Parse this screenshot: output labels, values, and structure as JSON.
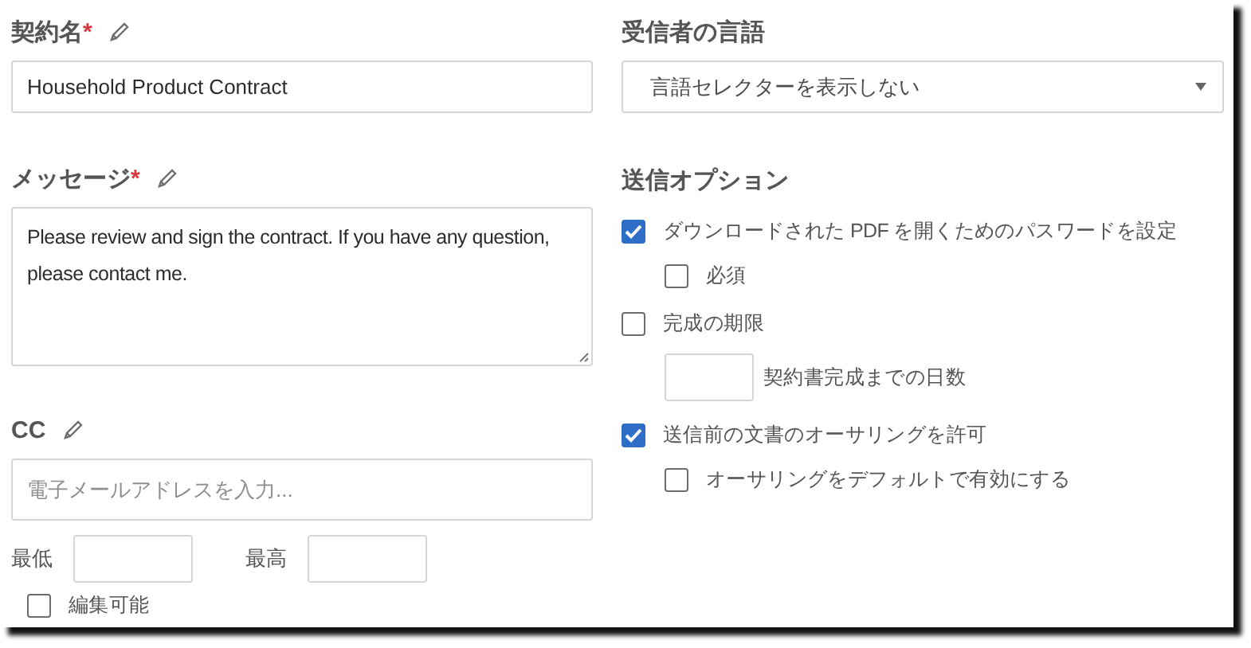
{
  "contract_name": {
    "label": "契約名",
    "required_mark": "*",
    "value": "Household Product Contract"
  },
  "message": {
    "label": "メッセージ",
    "required_mark": "*",
    "value": "Please review and sign the contract. If you have any question, please contact me."
  },
  "cc": {
    "label": "CC",
    "placeholder": "電子メールアドレスを入力..."
  },
  "limits": [
    {
      "label": "最低"
    },
    {
      "label": "最高"
    }
  ],
  "editable": {
    "label": "編集可能",
    "checked": false
  },
  "recipient_language": {
    "label": "受信者の言語",
    "value": "言語セレクターを表示しない"
  },
  "send_options": {
    "title": "送信オプション",
    "items": [
      {
        "kind": "checkbox",
        "label": "ダウンロードされた PDF を開くためのパスワードを設定",
        "checked": true,
        "children": [
          {
            "kind": "checkbox",
            "label": "必須",
            "checked": false
          }
        ]
      },
      {
        "kind": "checkbox",
        "label": "完成の期限",
        "checked": false,
        "children": [
          {
            "kind": "number",
            "label": "契約書完成までの日数"
          }
        ]
      },
      {
        "kind": "checkbox",
        "label": "送信前の文書のオーサリングを許可",
        "checked": true,
        "children": [
          {
            "kind": "checkbox",
            "label": "オーサリングをデフォルトで有効にする",
            "checked": false
          }
        ]
      }
    ]
  }
}
